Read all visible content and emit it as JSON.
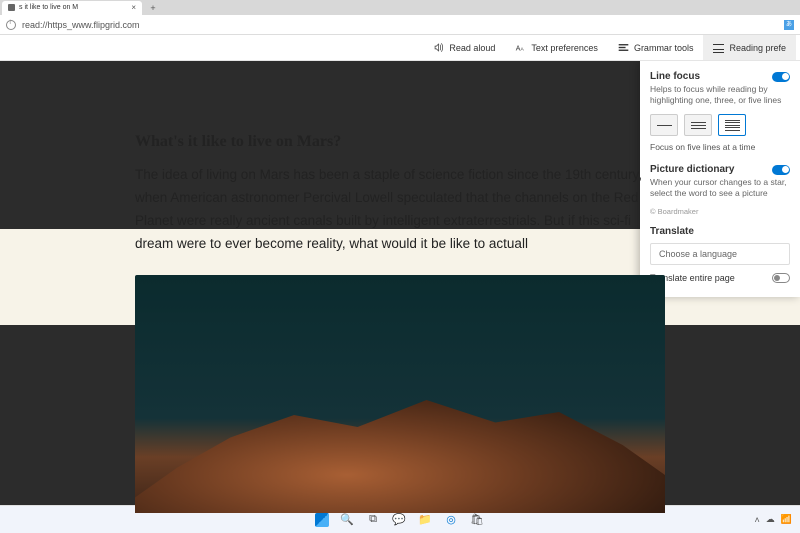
{
  "tab": {
    "title": "s it like to live on M"
  },
  "address": {
    "url": "read://https_www.flipgrid.com"
  },
  "readerbar": {
    "read_aloud": "Read aloud",
    "text_prefs": "Text preferences",
    "grammar": "Grammar tools",
    "reading_prefs": "Reading prefe"
  },
  "article": {
    "title": "What's it like to live on Mars?",
    "body": "The idea of living on Mars has been a staple of science fiction since the 19th century, when American astronomer Percival Lowell speculated that the channels on the Red Planet were really ancient canals built by intelligent extraterrestrials. But if this sci-fi dream were to ever become reality, what would it be like to actuall"
  },
  "panel": {
    "line_focus_title": "Line focus",
    "line_focus_desc": "Helps to focus while reading by highlighting one, three, or five lines",
    "line_focus_hint": "Focus on five lines at a time",
    "pict_dict_title": "Picture dictionary",
    "pict_dict_desc": "When your cursor changes to a star, select the word to see a picture",
    "pict_dict_credit": "© Boardmaker",
    "translate_title": "Translate",
    "translate_placeholder": "Choose a language",
    "translate_page": "Translate entire page"
  }
}
